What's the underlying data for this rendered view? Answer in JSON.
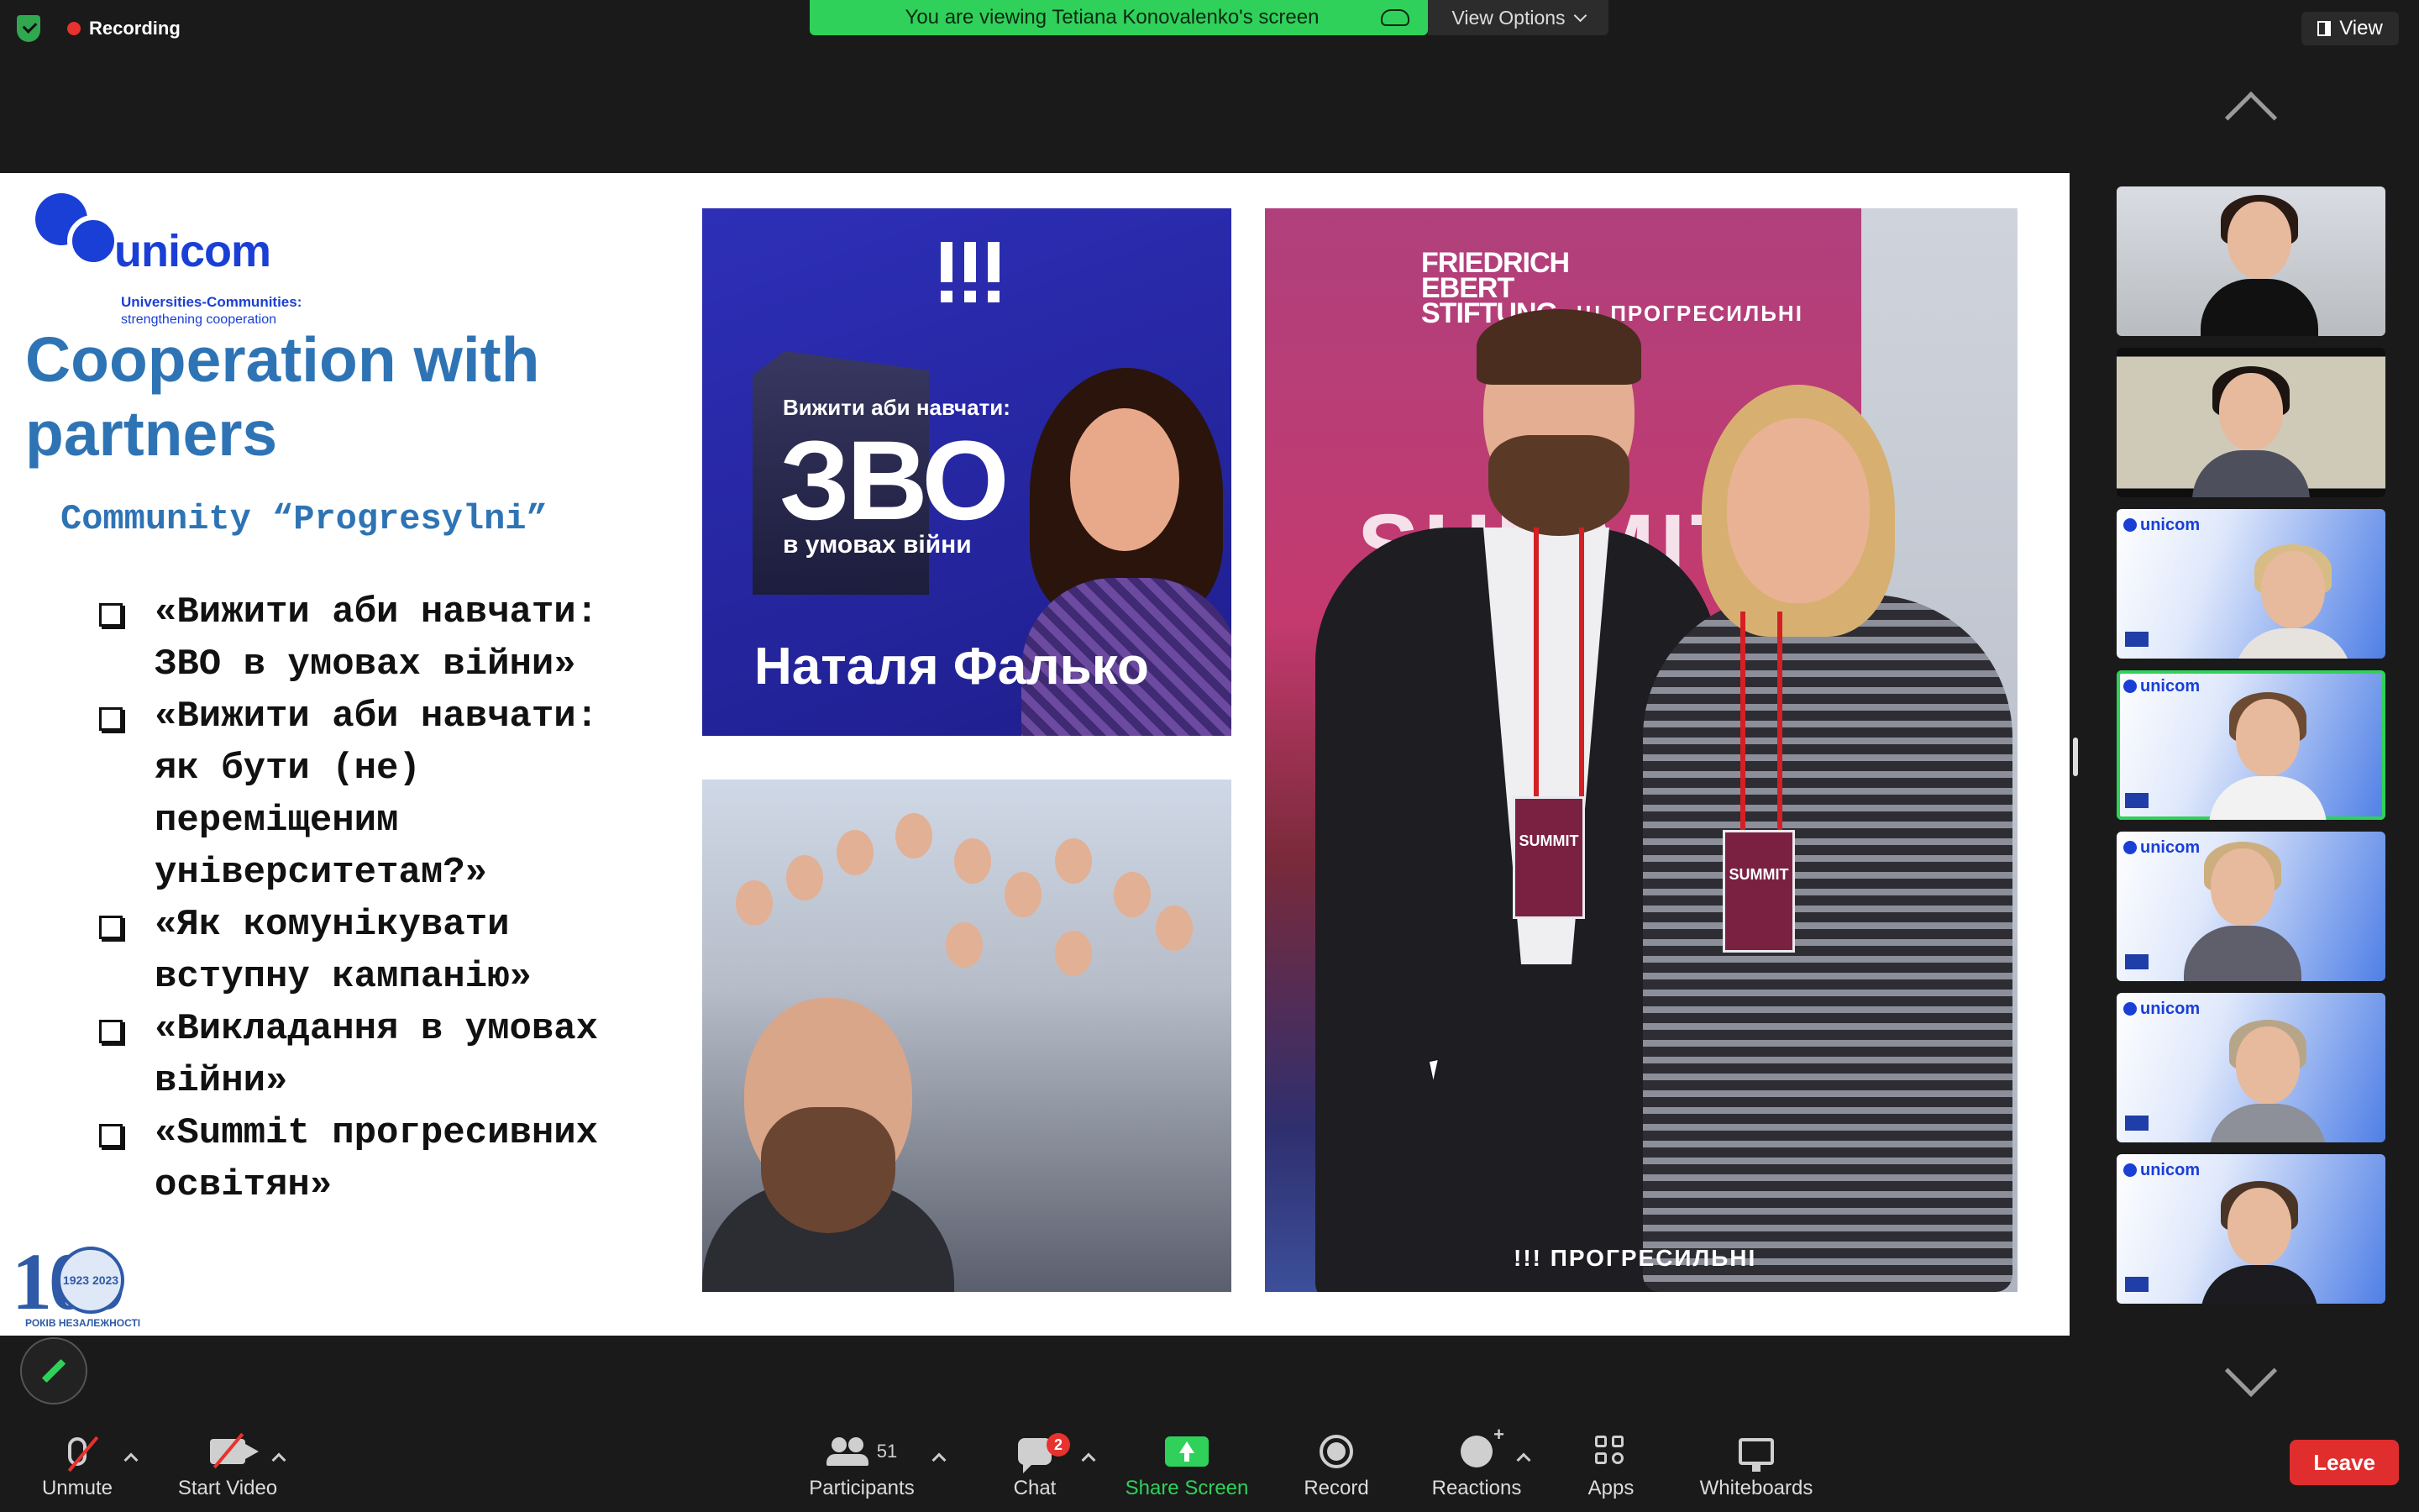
{
  "top_bar": {
    "recording_label": "Recording",
    "viewing_banner": "You are viewing Tetiana Konovalenko's screen",
    "view_options_label": "View Options",
    "view_label": "View"
  },
  "slide": {
    "logo": {
      "word": "unicom",
      "tagline_1": "Universities-Communities:",
      "tagline_2": "strengthening cooperation"
    },
    "title": "Cooperation with partners",
    "subtitle": "Community “Progresylni”",
    "bullets": [
      "«Вижити аби навчати: ЗВО в умовах війни»",
      "«Вижити аби навчати: як бути (не) переміщеним університетам?»",
      "«Як комунікувати вступну кампанію»",
      "«Викладання в умовах війни»",
      "«Summit прогресивних освітян»"
    ],
    "anniversary": {
      "number": "100",
      "years": "1923 2023",
      "caption": "РОКІВ НЕЗАЛЕЖНОСТІ"
    },
    "poster": {
      "mark": "!!!",
      "small_line": "Вижити аби навчати:",
      "big_text": "ЗВО",
      "under_text": "в умовах війни",
      "name": "Наталя Фалько"
    },
    "summit_photo": {
      "logo_lines": "FRIEDRICH EBERT STIFTUNG",
      "brand": "!!! ПРОГРЕСИЛЬНІ",
      "banner_text": "SUMMIT",
      "badge_text": "SUMMIT",
      "footer": "!!! ПРОГРЕСИЛЬНІ"
    }
  },
  "gallery": {
    "tile_logo": "unicom"
  },
  "toolbar": {
    "unmute_label": "Unmute",
    "start_video_label": "Start Video",
    "participants_label": "Participants",
    "participants_count": "51",
    "chat_label": "Chat",
    "chat_badge": "2",
    "share_screen_label": "Share Screen",
    "record_label": "Record",
    "reactions_label": "Reactions",
    "apps_label": "Apps",
    "whiteboards_label": "Whiteboards",
    "leave_label": "Leave"
  },
  "colors": {
    "accent_green": "#2fd15a",
    "leave_red": "#e02d2d",
    "slide_title_blue": "#2e74b5",
    "unicom_blue": "#1a3fd6"
  }
}
